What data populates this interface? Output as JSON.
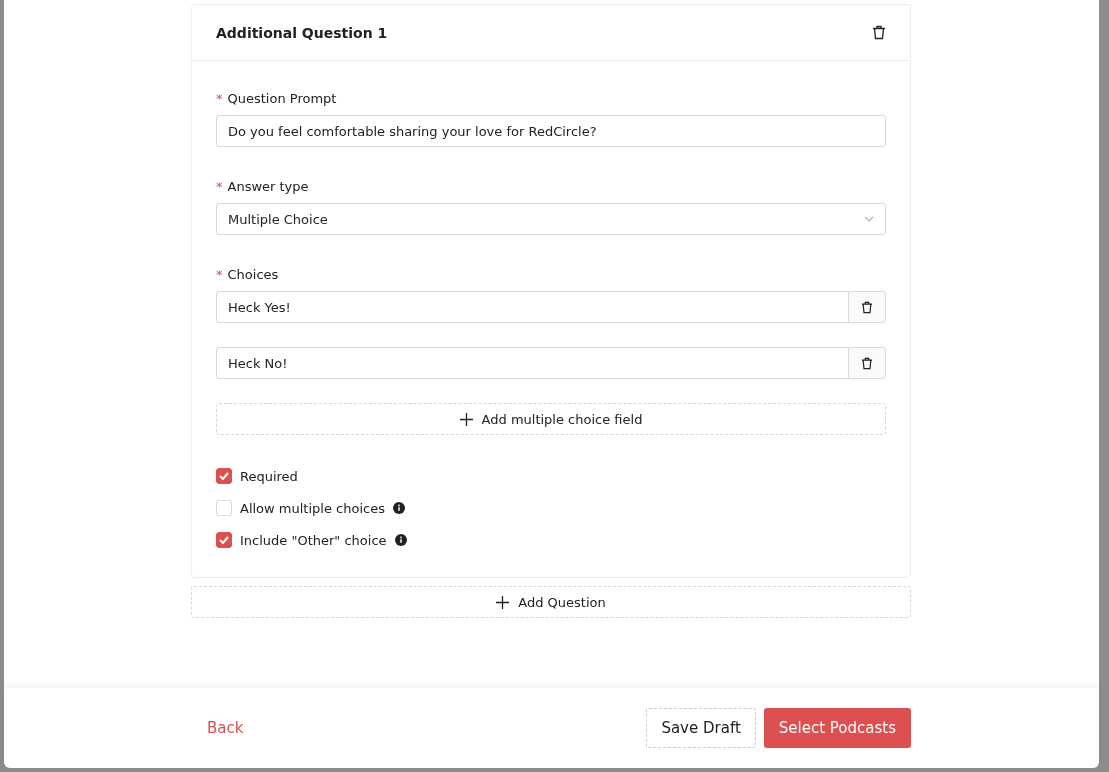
{
  "question_card": {
    "title": "Additional Question 1",
    "prompt_field": {
      "label": "Question Prompt",
      "required_mark": "*",
      "value": "Do you feel comfortable sharing your love for RedCircle?"
    },
    "answer_type": {
      "label": "Answer type",
      "required_mark": "*",
      "value": "Multiple Choice"
    },
    "choices": {
      "label": "Choices",
      "required_mark": "*",
      "items": [
        {
          "value": "Heck Yes!"
        },
        {
          "value": "Heck No!"
        }
      ],
      "add_button": "Add multiple choice field"
    },
    "options": [
      {
        "label": "Required",
        "checked": true,
        "info": false
      },
      {
        "label": "Allow multiple choices",
        "checked": false,
        "info": true
      },
      {
        "label": "Include \"Other\" choice",
        "checked": true,
        "info": true
      }
    ]
  },
  "add_question_button": "Add Question",
  "footer": {
    "back": "Back",
    "save_draft": "Save Draft",
    "primary": "Select Podcasts"
  }
}
